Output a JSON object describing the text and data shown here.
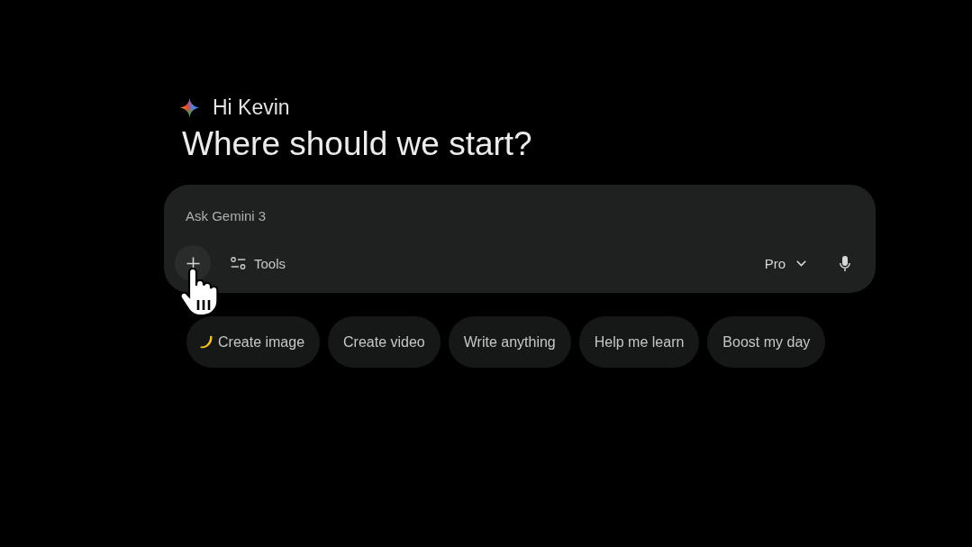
{
  "greeting": "Hi Kevin",
  "heading": "Where should we start?",
  "prompt": {
    "placeholder": "Ask Gemini 3",
    "tools": "Tools",
    "model": "Pro"
  },
  "suggestions": [
    {
      "label": "Create image",
      "kind": "icon"
    },
    {
      "label": "Create video",
      "kind": "plain"
    },
    {
      "label": "Write anything",
      "kind": "plain"
    },
    {
      "label": "Help me learn",
      "kind": "plain"
    },
    {
      "label": "Boost my day",
      "kind": "plain"
    }
  ]
}
